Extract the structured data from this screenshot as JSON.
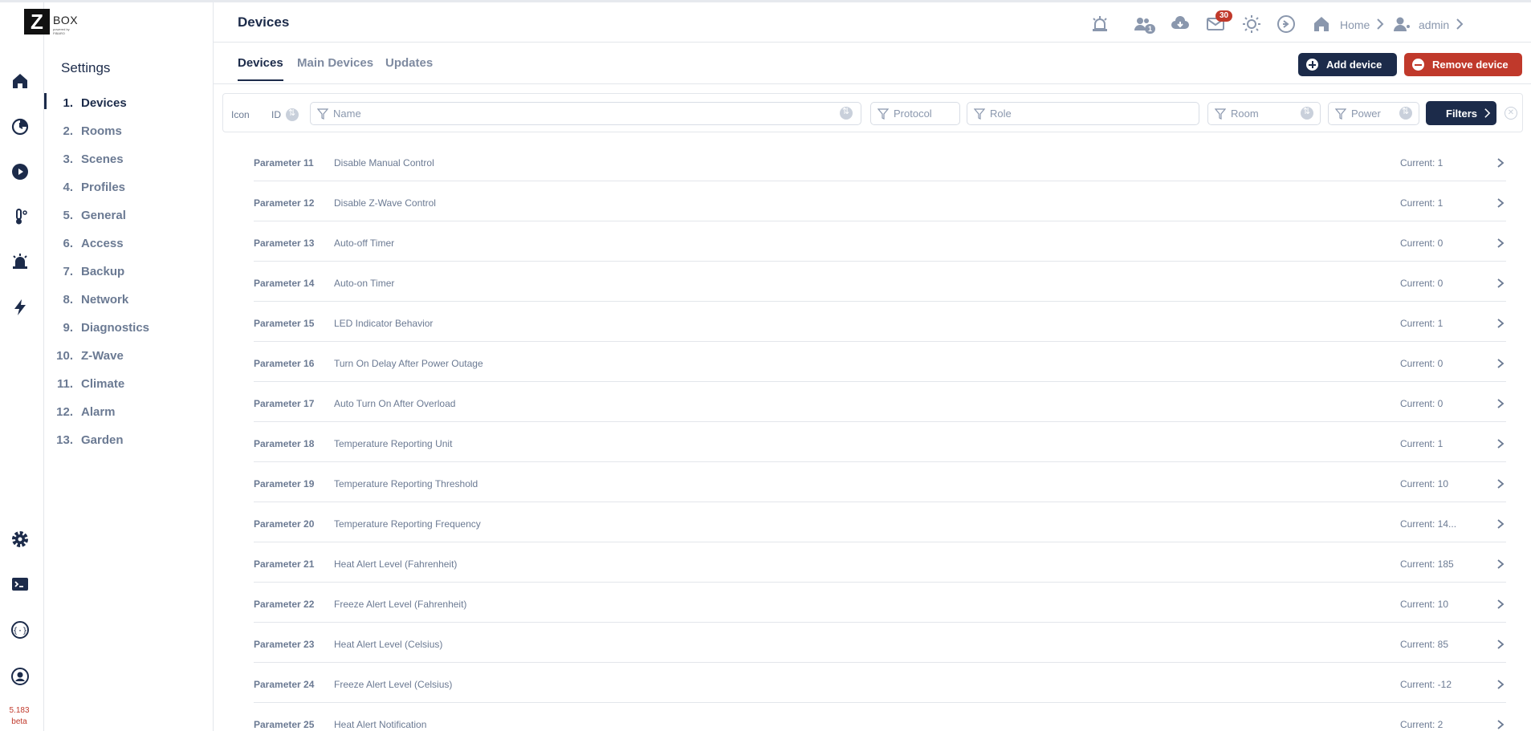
{
  "app": {
    "logo_letter": "Z",
    "logo_text": "BOX",
    "logo_tagline": "powered by FIBARO",
    "version": "5.183",
    "version_tag": "beta"
  },
  "header": {
    "title": "Devices",
    "users_count": "1",
    "messages_count": "30",
    "home_label": "Home",
    "user_label": "admin"
  },
  "sidebar": {
    "title": "Settings",
    "items": [
      {
        "num": "1.",
        "label": "Devices"
      },
      {
        "num": "2.",
        "label": "Rooms"
      },
      {
        "num": "3.",
        "label": "Scenes"
      },
      {
        "num": "4.",
        "label": "Profiles"
      },
      {
        "num": "5.",
        "label": "General"
      },
      {
        "num": "6.",
        "label": "Access"
      },
      {
        "num": "7.",
        "label": "Backup"
      },
      {
        "num": "8.",
        "label": "Network"
      },
      {
        "num": "9.",
        "label": "Diagnostics"
      },
      {
        "num": "10.",
        "label": "Z-Wave"
      },
      {
        "num": "11.",
        "label": "Climate"
      },
      {
        "num": "12.",
        "label": "Alarm"
      },
      {
        "num": "13.",
        "label": "Garden"
      }
    ]
  },
  "tabs": [
    {
      "label": "Devices"
    },
    {
      "label": "Main Devices"
    },
    {
      "label": "Updates"
    }
  ],
  "actions": {
    "add_label": "Add device",
    "remove_label": "Remove device"
  },
  "filters": {
    "icon_label": "Icon",
    "id_label": "ID",
    "name_placeholder": "Name",
    "protocol_placeholder": "Protocol",
    "role_placeholder": "Role",
    "room_placeholder": "Room",
    "power_placeholder": "Power",
    "filters_button": "Filters"
  },
  "parameters": [
    {
      "name": "Parameter 11",
      "desc": "Disable Manual Control",
      "current": "Current: 1"
    },
    {
      "name": "Parameter 12",
      "desc": "Disable Z-Wave Control",
      "current": "Current: 1"
    },
    {
      "name": "Parameter 13",
      "desc": "Auto-off Timer",
      "current": "Current: 0"
    },
    {
      "name": "Parameter 14",
      "desc": "Auto-on Timer",
      "current": "Current: 0"
    },
    {
      "name": "Parameter 15",
      "desc": "LED Indicator Behavior",
      "current": "Current: 1"
    },
    {
      "name": "Parameter 16",
      "desc": "Turn On Delay After Power Outage",
      "current": "Current: 0"
    },
    {
      "name": "Parameter 17",
      "desc": "Auto Turn On After Overload",
      "current": "Current: 0"
    },
    {
      "name": "Parameter 18",
      "desc": "Temperature Reporting Unit",
      "current": "Current: 1"
    },
    {
      "name": "Parameter 19",
      "desc": "Temperature Reporting Threshold",
      "current": "Current: 10"
    },
    {
      "name": "Parameter 20",
      "desc": "Temperature Reporting Frequency",
      "current": "Current: 14..."
    },
    {
      "name": "Parameter 21",
      "desc": "Heat Alert Level (Fahrenheit)",
      "current": "Current: 185"
    },
    {
      "name": "Parameter 22",
      "desc": "Freeze Alert Level (Fahrenheit)",
      "current": "Current: 10"
    },
    {
      "name": "Parameter 23",
      "desc": "Heat Alert Level (Celsius)",
      "current": "Current: 85"
    },
    {
      "name": "Parameter 24",
      "desc": "Freeze Alert Level (Celsius)",
      "current": "Current: -12"
    },
    {
      "name": "Parameter 25",
      "desc": "Heat Alert Notification",
      "current": "Current: 2"
    }
  ]
}
